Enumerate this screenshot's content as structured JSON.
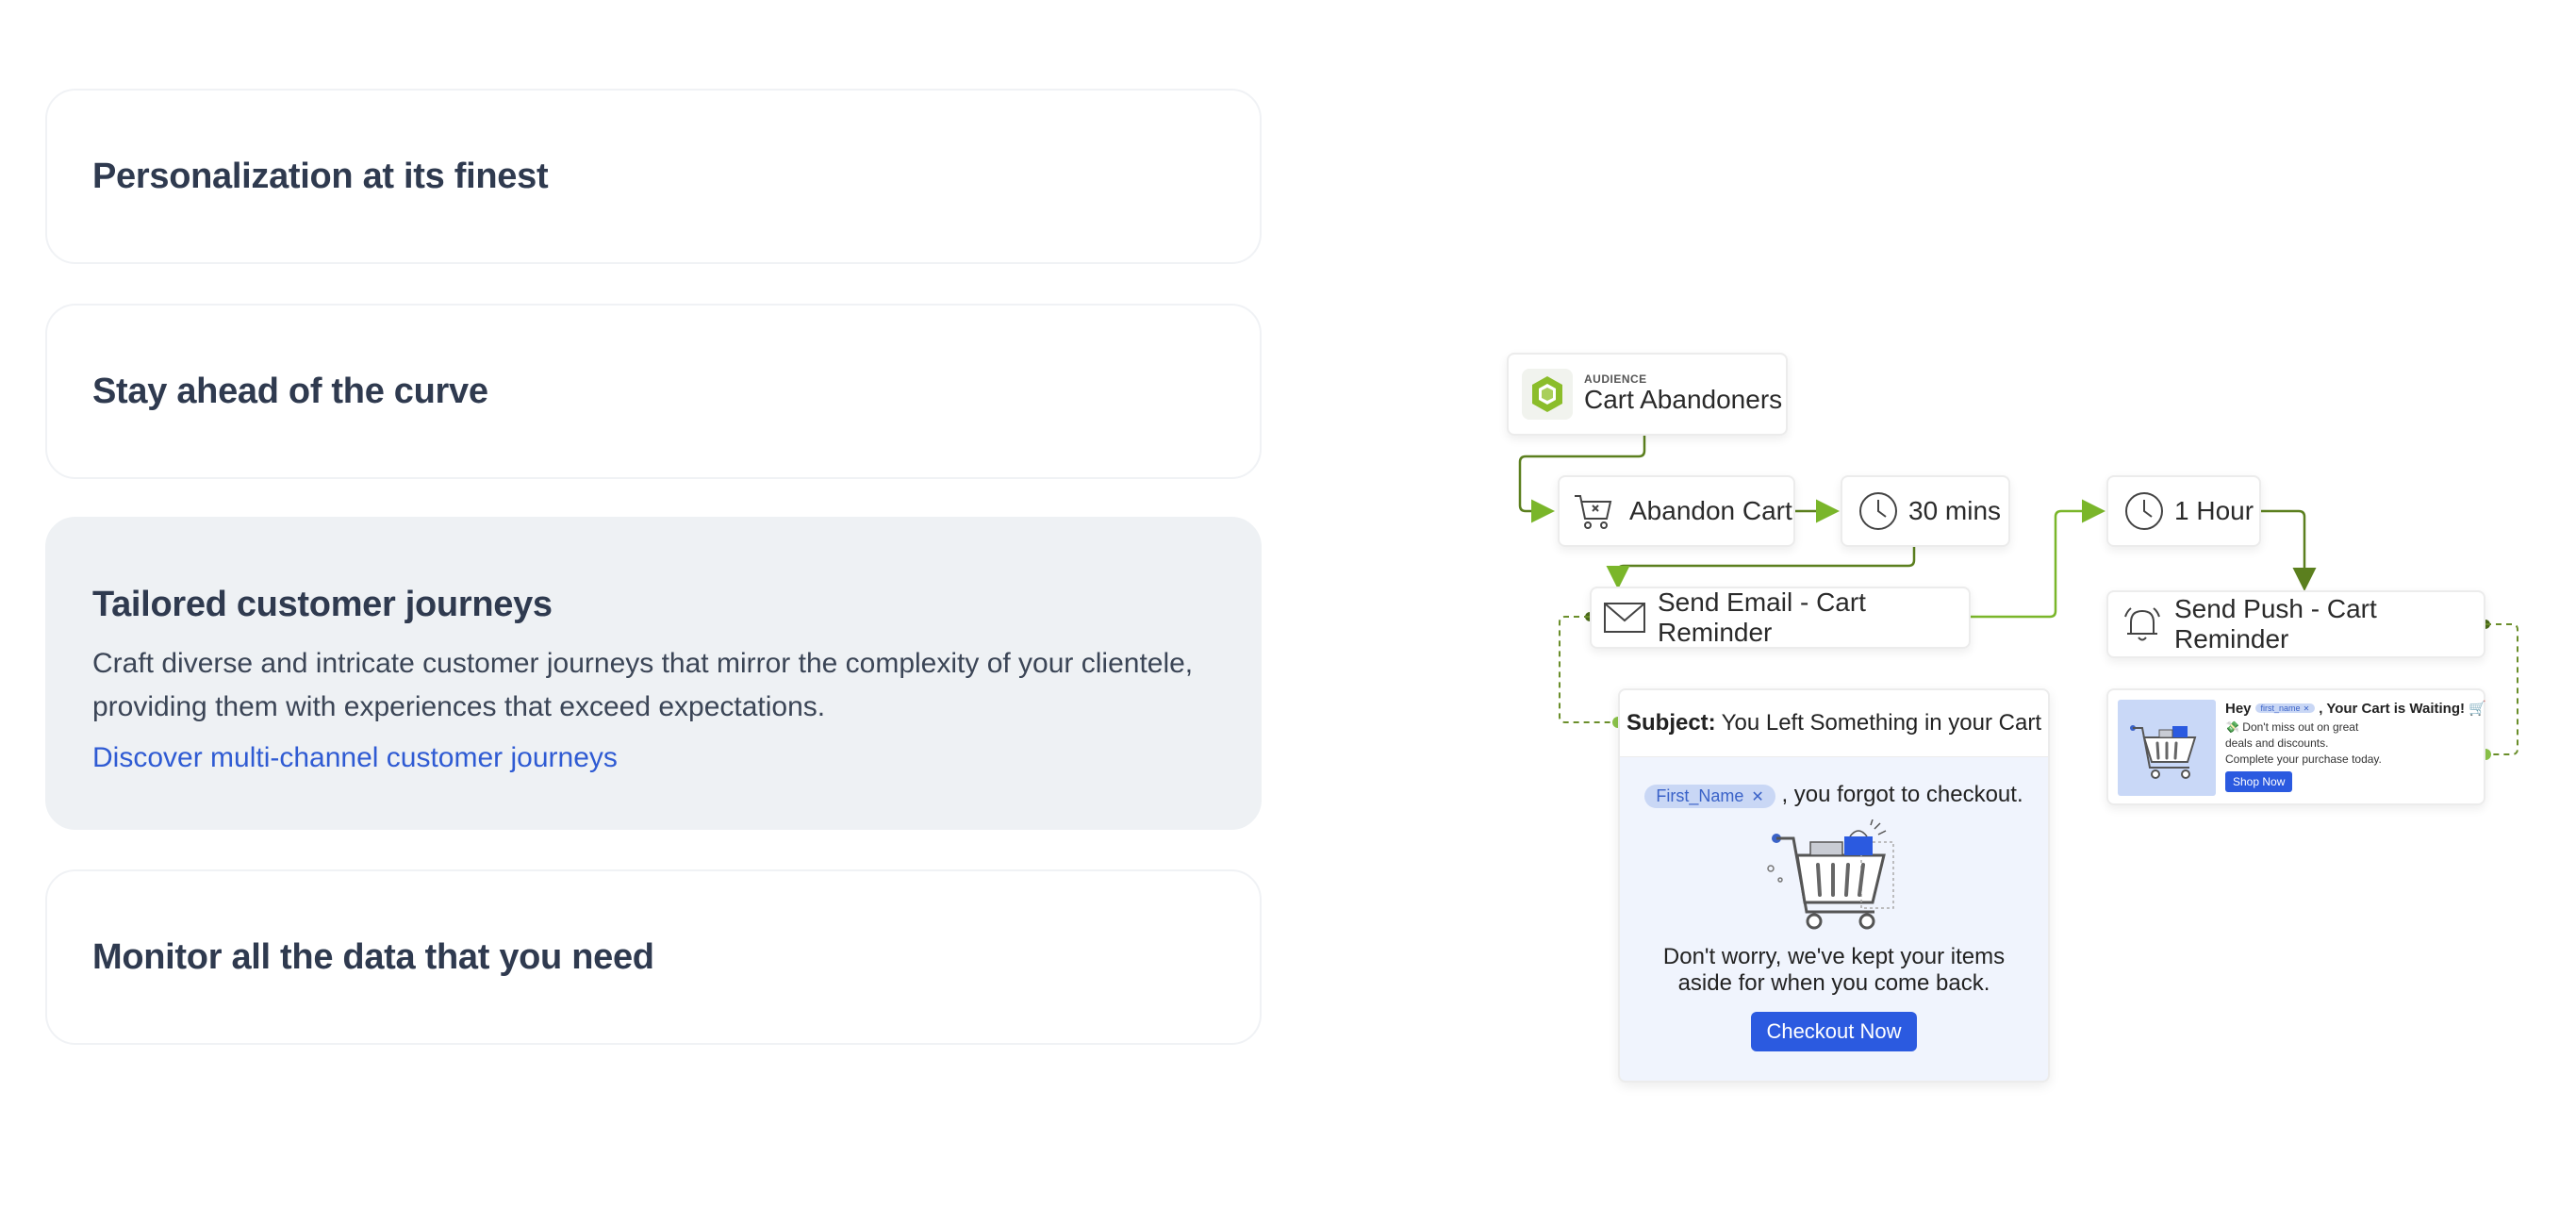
{
  "features": [
    {
      "title": "Personalization at its finest"
    },
    {
      "title": "Stay ahead of the curve"
    },
    {
      "title": "Tailored customer journeys",
      "description": "Craft diverse and intricate customer journeys that mirror the complexity of your clientele, providing them with experiences that exceed expectations.",
      "link": "Discover multi-channel customer journeys"
    },
    {
      "title": "Monitor all the data that you need"
    }
  ],
  "journey": {
    "audience": {
      "tag": "AUDIENCE",
      "name": "Cart Abandoners"
    },
    "trigger": "Abandon Cart",
    "wait1": "30 mins",
    "wait2": "1 Hour",
    "email_step": "Send Email - Cart Reminder",
    "push_step": "Send Push - Cart Reminder",
    "email": {
      "subject_label": "Subject:",
      "subject": "You Left Something in your Cart",
      "token": "First_Name",
      "greeting_suffix": ", you forgot to checkout.",
      "body": "Don't worry, we've kept your items aside for when you come back.",
      "cta": "Checkout Now"
    },
    "push": {
      "hey": "Hey",
      "token": "first_name",
      "title_suffix": ", Your Cart is Waiting! 🛒",
      "line1": "💸 Don't miss out on great",
      "line2": "deals and discounts.",
      "line3": "Complete your purchase today.",
      "cta": "Shop Now"
    },
    "colors": {
      "connector": "#7ab62a",
      "connector_dark": "#5b7f1e",
      "accent_blue": "#2b5ae0"
    }
  }
}
